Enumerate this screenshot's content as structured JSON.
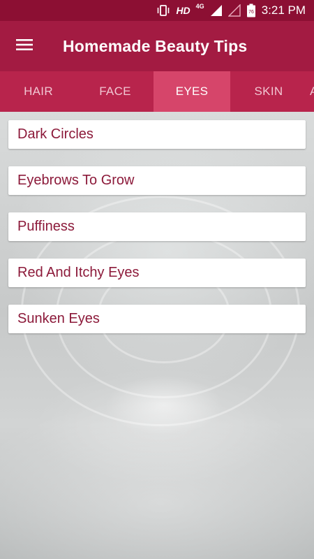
{
  "status_bar": {
    "network_hd": "HD",
    "network_type": "4G",
    "battery_level": "76",
    "time": "3:21 PM"
  },
  "app_bar": {
    "title": "Homemade Beauty Tips"
  },
  "tabs": [
    {
      "label": "HAIR",
      "active": false
    },
    {
      "label": "FACE",
      "active": false
    },
    {
      "label": "EYES",
      "active": true
    },
    {
      "label": "SKIN",
      "active": false
    },
    {
      "label": "A",
      "active": false
    }
  ],
  "list": {
    "items": [
      {
        "label": "Dark Circles"
      },
      {
        "label": "Eyebrows To Grow"
      },
      {
        "label": "Puffiness"
      },
      {
        "label": "Red And Itchy Eyes"
      },
      {
        "label": "Sunken Eyes"
      }
    ]
  },
  "colors": {
    "status_bar": "#8c0f33",
    "app_bar": "#a31b42",
    "tab_bar": "#b8244c",
    "tab_active": "#d6456a",
    "item_text": "#8c1a3a"
  },
  "icons": [
    "vibrate-icon",
    "signal-icon",
    "signal-empty-icon",
    "battery-icon",
    "menu-icon"
  ]
}
